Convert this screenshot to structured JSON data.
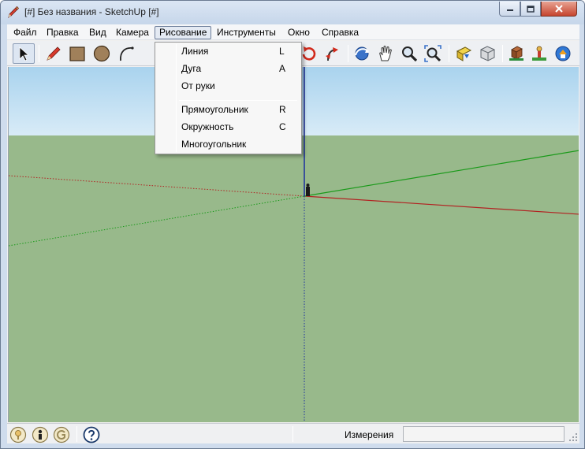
{
  "window": {
    "title": "[#] Без названия - SketchUp [#]",
    "app_icon": "sketchup-pencil-icon",
    "controls": [
      "minimize-icon",
      "maximize-icon",
      "close-icon"
    ]
  },
  "menubar": {
    "items": [
      {
        "label": "Файл"
      },
      {
        "label": "Правка"
      },
      {
        "label": "Вид"
      },
      {
        "label": "Камера"
      },
      {
        "label": "Рисование",
        "active": true
      },
      {
        "label": "Инструменты"
      },
      {
        "label": "Окно"
      },
      {
        "label": "Справка"
      }
    ]
  },
  "draw_menu": {
    "groups": [
      [
        {
          "label": "Линия",
          "shortcut": "L"
        },
        {
          "label": "Дуга",
          "shortcut": "A"
        },
        {
          "label": "От руки",
          "shortcut": ""
        }
      ],
      [
        {
          "label": "Прямоугольник",
          "shortcut": "R"
        },
        {
          "label": "Окружность",
          "shortcut": "C"
        },
        {
          "label": "Многоугольник",
          "shortcut": ""
        }
      ]
    ]
  },
  "toolbar": {
    "tools": [
      "select-arrow-icon",
      "pencil-line-icon",
      "rectangle-icon",
      "circle-icon",
      "arc-icon",
      "push-pull-icon",
      "rotate-icon",
      "follow-me-icon",
      "orbit-icon",
      "pan-hand-icon",
      "zoom-icon",
      "zoom-extents-icon",
      "get-models-icon",
      "share-model-icon",
      "components-icon",
      "location-icon",
      "google-earth-icon"
    ],
    "selected_tool": "select-arrow-icon"
  },
  "viewport": {
    "sky_color": "#a9d3ee",
    "ground_color": "#98b98b",
    "axis_red": "#b22222",
    "axis_green": "#1a9a1a",
    "axis_blue": "#1b2fa0"
  },
  "statusbar": {
    "icons": [
      "geo-location-icon",
      "credits-person-icon",
      "google-sign-in-icon",
      "help-question-icon"
    ],
    "hint": "",
    "measurements_label": "Измерения",
    "measurements_value": ""
  }
}
